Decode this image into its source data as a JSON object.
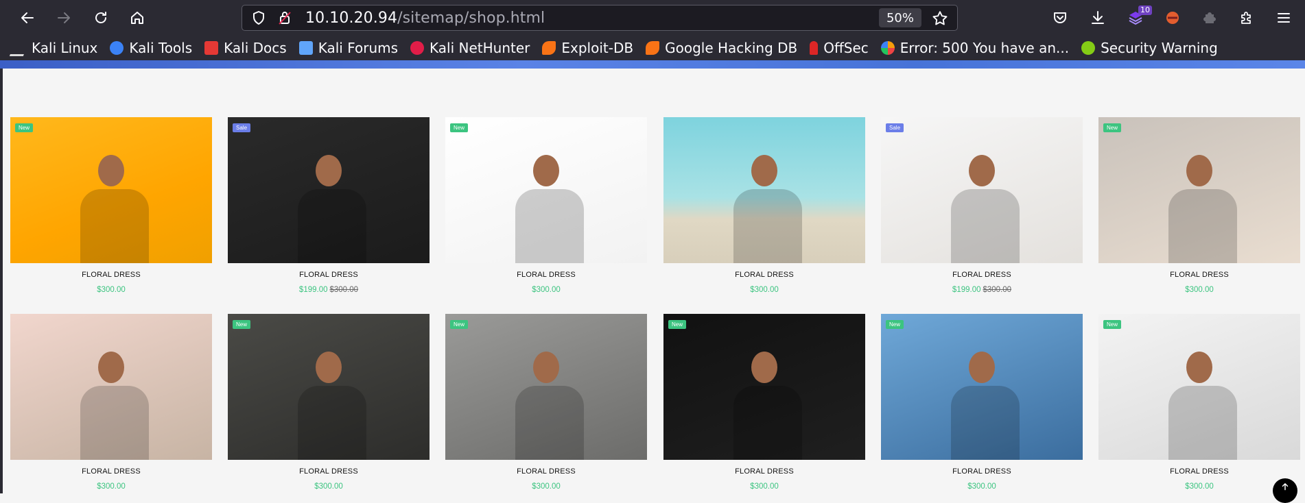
{
  "browser": {
    "url_host": "10.10.20.94",
    "url_path": "/sitemap/shop.html",
    "zoom": "50%",
    "extension_badge": "10"
  },
  "bookmarks": [
    {
      "label": "Kali Linux",
      "icon": "kali-dragon-icon",
      "color": "#e6e6e6"
    },
    {
      "label": "Kali Tools",
      "icon": "kali-tools-icon",
      "color": "#3b82f6"
    },
    {
      "label": "Kali Docs",
      "icon": "kali-docs-icon",
      "color": "#e53935"
    },
    {
      "label": "Kali Forums",
      "icon": "kali-forums-icon",
      "color": "#60a5fa"
    },
    {
      "label": "Kali NetHunter",
      "icon": "kali-nethunter-icon",
      "color": "#e11d48"
    },
    {
      "label": "Exploit-DB",
      "icon": "exploit-db-icon",
      "color": "#f97316"
    },
    {
      "label": "Google Hacking DB",
      "icon": "ghdb-icon",
      "color": "#f97316"
    },
    {
      "label": "OffSec",
      "icon": "offsec-icon",
      "color": "#dc2626"
    },
    {
      "label": "Error: 500 You have an...",
      "icon": "joomla-icon",
      "color": "#f59e0b"
    },
    {
      "label": "Security Warning",
      "icon": "security-warning-icon",
      "color": "#84cc16"
    }
  ],
  "products": [
    {
      "name": "FLORAL DRESS",
      "price": "$300.00",
      "old_price": "",
      "tag": "New",
      "tag_color": "#3cc480",
      "bg": "linear-gradient(160deg,#ffb81c 0%,#ffa500 60%,#f0a000 100%)",
      "figure": "woman-pink-top-icon"
    },
    {
      "name": "FLORAL DRESS",
      "price": "$199.00",
      "old_price": "$300.00",
      "tag": "Sale",
      "tag_color": "#6b7ee8",
      "bg": "linear-gradient(160deg,#2a2a2a 0%,#1b1b1b 100%)",
      "figure": "man-white-tee-icon"
    },
    {
      "name": "FLORAL DRESS",
      "price": "$300.00",
      "old_price": "",
      "tag": "New",
      "tag_color": "#3cc480",
      "bg": "linear-gradient(160deg,#ffffff 0%,#f2f2f2 100%)",
      "figure": "woman-grey-tee-icon"
    },
    {
      "name": "FLORAL DRESS",
      "price": "$300.00",
      "old_price": "",
      "tag": "",
      "tag_color": "",
      "bg": "linear-gradient(180deg,#7ed3de 0%,#a9e2e5 55%,#e0d8c4 70%,#d8cfbb 100%)",
      "figure": "yellow-tracksuit-icon"
    },
    {
      "name": "FLORAL DRESS",
      "price": "$199.00",
      "old_price": "$300.00",
      "tag": "Sale",
      "tag_color": "#6b7ee8",
      "bg": "linear-gradient(160deg,#f6f6f6 0%,#e4e1dd 100%)",
      "figure": "man-navy-suit-icon"
    },
    {
      "name": "FLORAL DRESS",
      "price": "$300.00",
      "old_price": "",
      "tag": "New",
      "tag_color": "#3cc480",
      "bg": "linear-gradient(160deg,#c9c2bb 0%,#e9ddd0 100%)",
      "figure": "woman-red-tee-icon"
    },
    {
      "name": "FLORAL DRESS",
      "price": "$300.00",
      "old_price": "",
      "tag": "",
      "tag_color": "",
      "bg": "linear-gradient(160deg,#f1d6cd 0%,#c7b4a4 100%)",
      "figure": "woman-striped-top-icon"
    },
    {
      "name": "FLORAL DRESS",
      "price": "$300.00",
      "old_price": "",
      "tag": "New",
      "tag_color": "#3cc480",
      "bg": "linear-gradient(160deg,#4a4a46 0%,#2d2d2b 100%)",
      "figure": "woman-knit-sweater-icon"
    },
    {
      "name": "FLORAL DRESS",
      "price": "$300.00",
      "old_price": "",
      "tag": "New",
      "tag_color": "#3cc480",
      "bg": "linear-gradient(160deg,#9a9a98 0%,#6c6c6a 100%)",
      "figure": "woman-black-coat-icon"
    },
    {
      "name": "FLORAL DRESS",
      "price": "$300.00",
      "old_price": "",
      "tag": "New",
      "tag_color": "#3cc480",
      "bg": "linear-gradient(160deg,#111111 0%,#1f1f1f 100%)",
      "figure": "woman-brown-coat-icon"
    },
    {
      "name": "FLORAL DRESS",
      "price": "$300.00",
      "old_price": "",
      "tag": "New",
      "tag_color": "#3cc480",
      "bg": "linear-gradient(160deg,#6fa8d8 0%,#3b6d9e 100%)",
      "figure": "woman-teal-jumpsuit-icon"
    },
    {
      "name": "FLORAL DRESS",
      "price": "$300.00",
      "old_price": "",
      "tag": "New",
      "tag_color": "#3cc480",
      "bg": "linear-gradient(160deg,#f3f3f3 0%,#d9d9d9 100%)",
      "figure": "woman-fur-bag-icon"
    }
  ]
}
